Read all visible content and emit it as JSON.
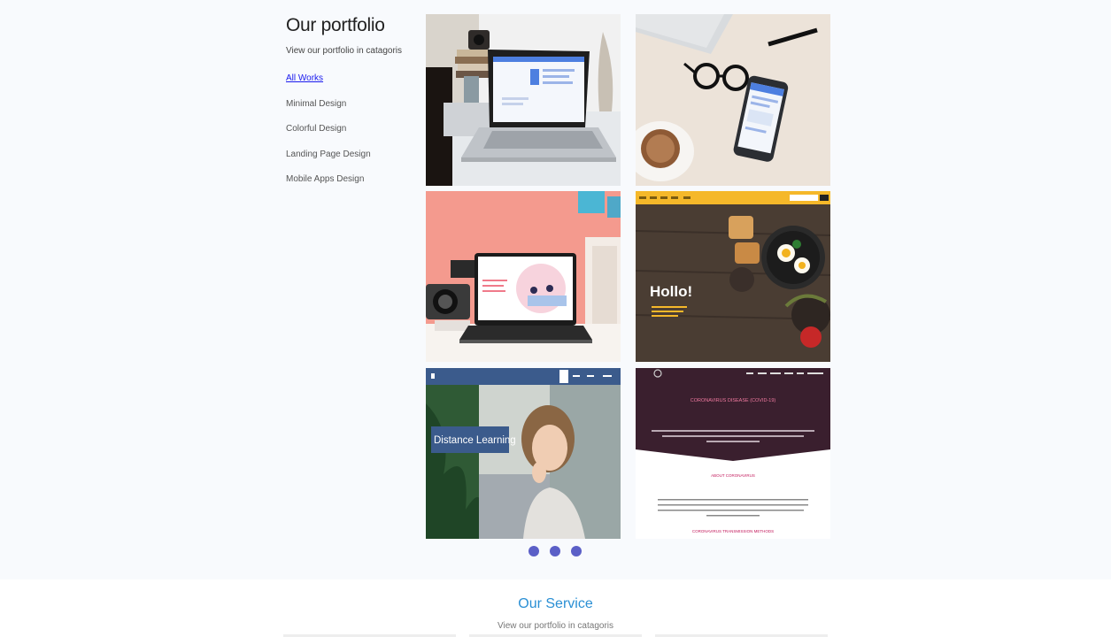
{
  "portfolio": {
    "title": "Our portfolio",
    "subtitle": "View our portfolio in catagoris",
    "categories": [
      {
        "label": "All Works",
        "active": true
      },
      {
        "label": "Minimal Design",
        "active": false
      },
      {
        "label": "Colorful Design",
        "active": false
      },
      {
        "label": "Landing Page Design",
        "active": false
      },
      {
        "label": "Mobile Apps Design",
        "active": false
      }
    ],
    "items": [
      {
        "label": "laptop-mockup-desk"
      },
      {
        "label": "phone-mockup-coffee"
      },
      {
        "label": "laptop-mockup-pink"
      },
      {
        "label": "food-website",
        "hero_text": "Hollo!"
      },
      {
        "label": "distance-learning-website",
        "hero_text": "Distance Learning"
      },
      {
        "label": "coronavirus-website",
        "hero_text": "CORONAVIRUS DISEASE (COVID-19)",
        "section_text": "ABOUT CORONAVIRUS",
        "footer_text": "CORONAVIRUS TRANSMISSION METHODS"
      }
    ],
    "pager": {
      "count": 3,
      "color": "#5b5fc7"
    }
  },
  "service": {
    "title": "Our Service",
    "subtitle": "View our portfolio in catagoris"
  },
  "colors": {
    "link_active": "#1a1aee",
    "service_title": "#2a8fd4",
    "section_bg": "#f8fafd"
  }
}
